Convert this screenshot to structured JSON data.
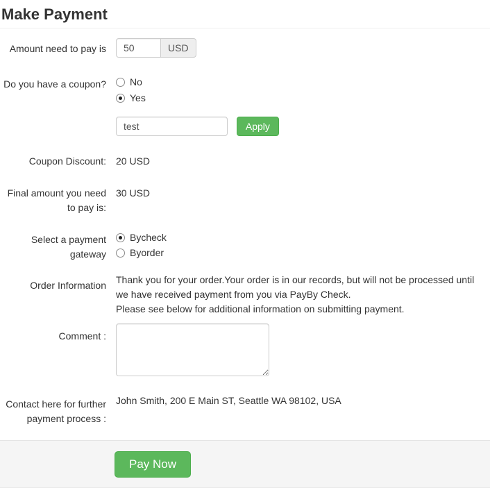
{
  "page": {
    "title": "Make Payment"
  },
  "form": {
    "amount": {
      "label": "Amount need to pay is",
      "value": "50",
      "currency": "USD"
    },
    "coupon_question": {
      "label": "Do you have a coupon?",
      "options": [
        {
          "label": "No",
          "checked": false
        },
        {
          "label": "Yes",
          "checked": true
        }
      ]
    },
    "coupon_code": {
      "value": "test",
      "apply_label": "Apply"
    },
    "coupon_discount": {
      "label": "Coupon Discount:",
      "value": "20 USD"
    },
    "final_amount": {
      "label": "Final amount you need to pay is:",
      "value": "30 USD"
    },
    "gateway": {
      "label": "Select a payment gateway",
      "options": [
        {
          "label": "Bycheck",
          "checked": true
        },
        {
          "label": "Byorder",
          "checked": false
        }
      ]
    },
    "order_information": {
      "label": "Order Information",
      "line1": "Thank you for your order.Your order is in our records, but will not be processed until we have received payment from you via PayBy Check.",
      "line2": "Please see below for additional information on submitting payment."
    },
    "comment": {
      "label": "Comment :",
      "value": ""
    },
    "contact": {
      "label": "Contact here for further payment process :",
      "value": "John Smith, 200 E Main ST, Seattle WA 98102, USA"
    },
    "submit_label": "Pay Now"
  },
  "colors": {
    "accent_green": "#5cb85c",
    "accent_green_border": "#4cae4c",
    "footer_bg": "#f5f5f5",
    "divider": "#e4e4e4"
  }
}
